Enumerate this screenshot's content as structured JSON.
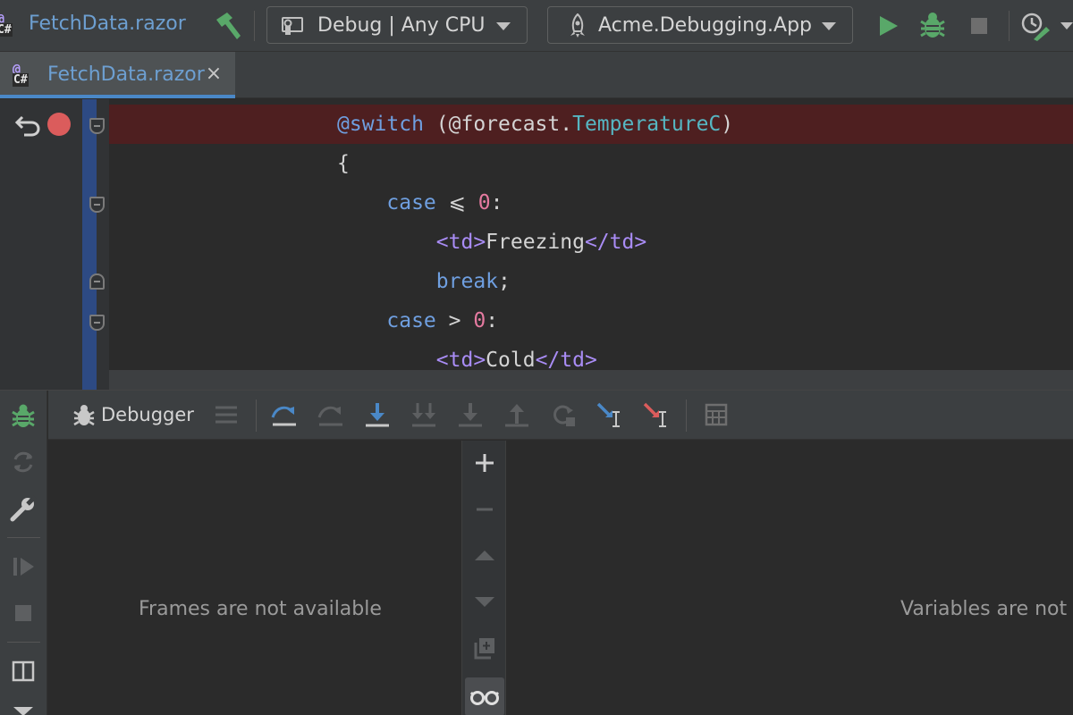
{
  "toolbar": {
    "file_name": "FetchData.razor",
    "config_label": "Debug | Any CPU",
    "run_target_label": "Acme.Debugging.App"
  },
  "tab": {
    "label": "FetchData.razor",
    "close_glyph": "×"
  },
  "file_icon": {
    "at": "@",
    "lang": "C#"
  },
  "code_lines": [
    [
      {
        "t": "@switch",
        "c": "kw"
      },
      {
        "t": " (@forecast.",
        "c": "plain"
      },
      {
        "t": "TemperatureC",
        "c": "fld"
      },
      {
        "t": ")",
        "c": "plain"
      }
    ],
    [
      {
        "t": "{",
        "c": "plain"
      }
    ],
    [
      {
        "t": "    case",
        "c": "kw"
      },
      {
        "t": " ⩽ ",
        "c": "plain"
      },
      {
        "t": "0",
        "c": "num"
      },
      {
        "t": ":",
        "c": "plain"
      }
    ],
    [
      {
        "t": "        <td>",
        "c": "tag"
      },
      {
        "t": "Freezing",
        "c": "plain"
      },
      {
        "t": "</td>",
        "c": "tag"
      }
    ],
    [
      {
        "t": "        break",
        "c": "kw"
      },
      {
        "t": ";",
        "c": "plain"
      }
    ],
    [
      {
        "t": "    case",
        "c": "kw"
      },
      {
        "t": " > ",
        "c": "plain"
      },
      {
        "t": "0",
        "c": "num"
      },
      {
        "t": ":",
        "c": "plain"
      }
    ],
    [
      {
        "t": "        <td>",
        "c": "tag"
      },
      {
        "t": "Cold",
        "c": "plain"
      },
      {
        "t": "</td>",
        "c": "tag"
      }
    ]
  ],
  "debugger": {
    "tab_label": "Debugger",
    "frames_empty": "Frames are not available",
    "variables_empty": "Variables are not a"
  },
  "colors": {
    "accent": "#4a88c7",
    "run_green": "#59a869",
    "breakpoint_red": "#db5c5c",
    "breakpoint_line": "#4e1f20"
  },
  "icons": {
    "build": "hammer-icon",
    "run": "play-icon",
    "debug": "bug-icon",
    "stop": "stop-icon",
    "profile": "profiler-icon"
  }
}
